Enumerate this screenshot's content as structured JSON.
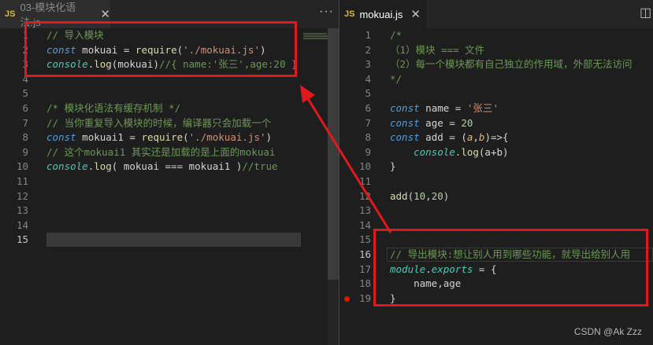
{
  "left_tab": {
    "badge": "JS",
    "name": "03-模块化语法.js",
    "close": "✕"
  },
  "left_actions": "···",
  "right_tab": {
    "badge": "JS",
    "name": "mokuai.js",
    "close": "✕"
  },
  "right_actions": "◫",
  "left_lines": [
    {
      "n": "1",
      "tokens": [
        {
          "t": "// 导入模块",
          "c": "cm"
        }
      ]
    },
    {
      "n": "2",
      "tokens": [
        {
          "t": "const",
          "c": "kw"
        },
        {
          "t": " mokuai ",
          "c": "var"
        },
        {
          "t": "= ",
          "c": "var"
        },
        {
          "t": "require",
          "c": "fn"
        },
        {
          "t": "(",
          "c": "var"
        },
        {
          "t": "'./mokuai.js'",
          "c": "str"
        },
        {
          "t": ")",
          "c": "var"
        }
      ]
    },
    {
      "n": "3",
      "tokens": [
        {
          "t": "console",
          "c": "obj"
        },
        {
          "t": ".",
          "c": "var"
        },
        {
          "t": "log",
          "c": "fn"
        },
        {
          "t": "(mokuai)",
          "c": "var"
        },
        {
          "t": "//{ name:'张三',age:20 }",
          "c": "cm"
        }
      ]
    },
    {
      "n": "4",
      "tokens": []
    },
    {
      "n": "5",
      "tokens": []
    },
    {
      "n": "6",
      "tokens": [
        {
          "t": "/* 模块化语法有缓存机制 */",
          "c": "cm"
        }
      ]
    },
    {
      "n": "7",
      "tokens": [
        {
          "t": "// 当你重复导入模块的时候，编译器只会加载一个",
          "c": "cm"
        }
      ]
    },
    {
      "n": "8",
      "tokens": [
        {
          "t": "const",
          "c": "kw"
        },
        {
          "t": " mokuai1 ",
          "c": "var"
        },
        {
          "t": "= ",
          "c": "var"
        },
        {
          "t": "require",
          "c": "fn"
        },
        {
          "t": "(",
          "c": "var"
        },
        {
          "t": "'./mokuai.js'",
          "c": "str"
        },
        {
          "t": ")",
          "c": "var"
        }
      ]
    },
    {
      "n": "9",
      "tokens": [
        {
          "t": "// 这个mokuai1 其实还是加载的是上面的mokuai",
          "c": "cm"
        }
      ]
    },
    {
      "n": "10",
      "tokens": [
        {
          "t": "console",
          "c": "obj"
        },
        {
          "t": ".",
          "c": "var"
        },
        {
          "t": "log",
          "c": "fn"
        },
        {
          "t": "( mokuai === mokuai1 )",
          "c": "var"
        },
        {
          "t": "//true",
          "c": "cm"
        }
      ]
    },
    {
      "n": "11",
      "tokens": []
    },
    {
      "n": "12",
      "tokens": []
    },
    {
      "n": "13",
      "tokens": []
    },
    {
      "n": "14",
      "tokens": []
    },
    {
      "n": "15",
      "tokens": [],
      "current": true
    }
  ],
  "right_lines": [
    {
      "n": "1",
      "tokens": [
        {
          "t": "/*",
          "c": "cm"
        }
      ]
    },
    {
      "n": "2",
      "tokens": [
        {
          "t": "（1）模块 === 文件",
          "c": "cm"
        }
      ]
    },
    {
      "n": "3",
      "tokens": [
        {
          "t": "（2）每一个模块都有自己独立的作用域，外部无法访问",
          "c": "cm"
        }
      ]
    },
    {
      "n": "4",
      "tokens": [
        {
          "t": "*/",
          "c": "cm"
        }
      ]
    },
    {
      "n": "5",
      "tokens": []
    },
    {
      "n": "6",
      "tokens": [
        {
          "t": "const",
          "c": "kw"
        },
        {
          "t": " name ",
          "c": "var"
        },
        {
          "t": "= ",
          "c": "var"
        },
        {
          "t": "'张三'",
          "c": "str"
        }
      ]
    },
    {
      "n": "7",
      "tokens": [
        {
          "t": "const",
          "c": "kw"
        },
        {
          "t": " age ",
          "c": "var"
        },
        {
          "t": "= ",
          "c": "var"
        },
        {
          "t": "20",
          "c": "num"
        }
      ]
    },
    {
      "n": "8",
      "tokens": [
        {
          "t": "const",
          "c": "kw"
        },
        {
          "t": " add ",
          "c": "var"
        },
        {
          "t": "= (",
          "c": "var"
        },
        {
          "t": "a",
          "c": "prm"
        },
        {
          "t": ",",
          "c": "var"
        },
        {
          "t": "b",
          "c": "prm"
        },
        {
          "t": ")=>{",
          "c": "var"
        }
      ]
    },
    {
      "n": "9",
      "tokens": [
        {
          "t": "    ",
          "c": "var"
        },
        {
          "t": "console",
          "c": "obj"
        },
        {
          "t": ".",
          "c": "var"
        },
        {
          "t": "log",
          "c": "fn"
        },
        {
          "t": "(a+b)",
          "c": "var"
        }
      ]
    },
    {
      "n": "10",
      "tokens": [
        {
          "t": "}",
          "c": "var"
        }
      ]
    },
    {
      "n": "11",
      "tokens": []
    },
    {
      "n": "12",
      "tokens": [
        {
          "t": "add",
          "c": "fn"
        },
        {
          "t": "(",
          "c": "var"
        },
        {
          "t": "10",
          "c": "num"
        },
        {
          "t": ",",
          "c": "var"
        },
        {
          "t": "20",
          "c": "num"
        },
        {
          "t": ")",
          "c": "var"
        }
      ]
    },
    {
      "n": "13",
      "tokens": []
    },
    {
      "n": "14",
      "tokens": []
    },
    {
      "n": "15",
      "tokens": []
    },
    {
      "n": "16",
      "tokens": [
        {
          "t": "// 导出模块:想让别人用到哪些功能，就导出给别人用",
          "c": "cm"
        }
      ],
      "current": true
    },
    {
      "n": "17",
      "tokens": [
        {
          "t": "module",
          "c": "obj"
        },
        {
          "t": ".",
          "c": "var"
        },
        {
          "t": "exports",
          "c": "obj"
        },
        {
          "t": " = {",
          "c": "var"
        }
      ]
    },
    {
      "n": "18",
      "tokens": [
        {
          "t": "    name,age",
          "c": "var"
        }
      ]
    },
    {
      "n": "19",
      "tokens": [
        {
          "t": "}",
          "c": "var"
        }
      ],
      "breakpoint": true
    }
  ],
  "watermark": "CSDN @Ak Zzz",
  "colors": {
    "highlight_box": "#e0191e",
    "editor_bg": "#1e1e1e"
  }
}
